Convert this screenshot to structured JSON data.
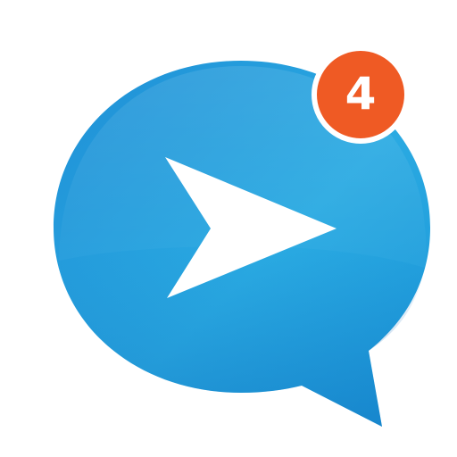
{
  "app_icon": {
    "icon": "chat-bubble-send-icon",
    "colors": {
      "bubble_light": "#2aaae2",
      "bubble_mid": "#1b96d8",
      "bubble_dark": "#0f74c4",
      "arrow": "#ffffff"
    }
  },
  "notification": {
    "count": "4",
    "color": "#ef5a24",
    "text_color": "#ffffff"
  }
}
